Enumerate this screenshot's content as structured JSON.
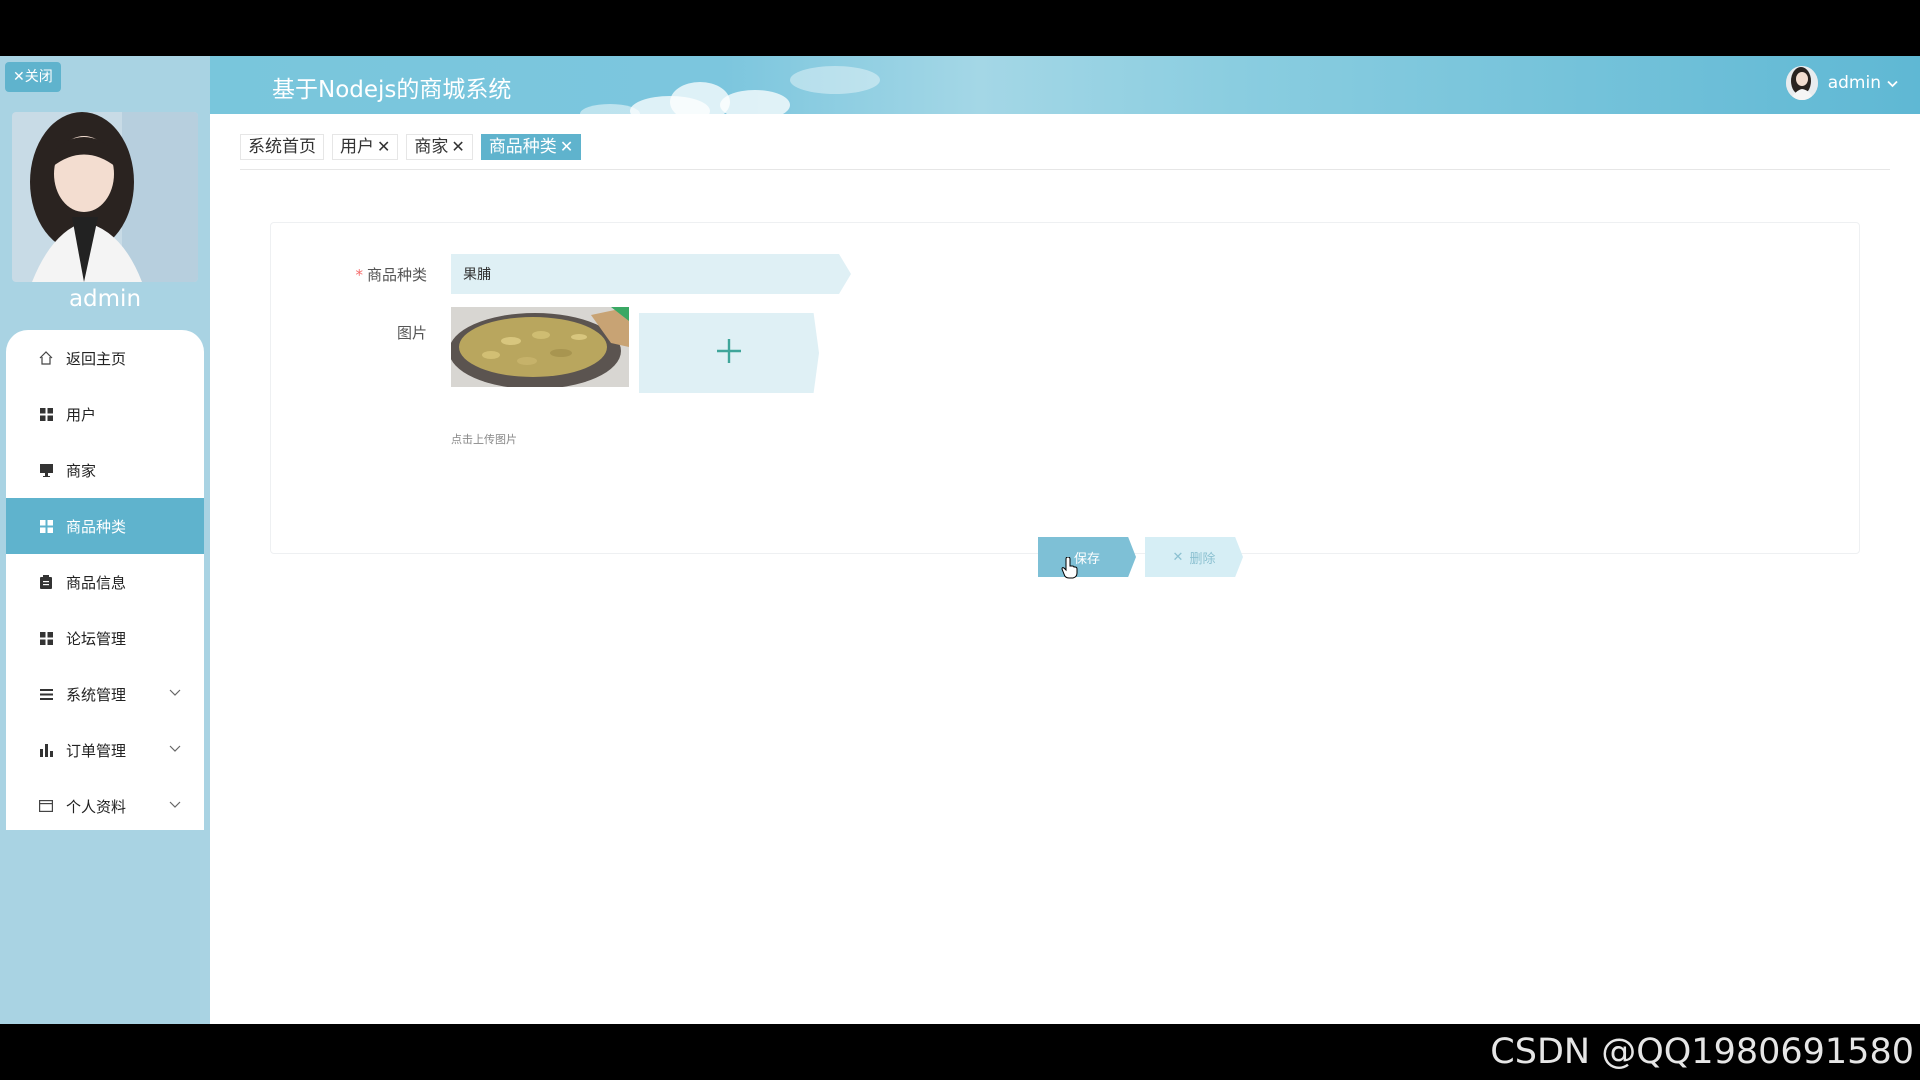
{
  "sidebar": {
    "close_label": "✕关闭",
    "username": "admin",
    "items": [
      {
        "label": "返回主页"
      },
      {
        "label": "用户"
      },
      {
        "label": "商家"
      },
      {
        "label": "商品种类"
      },
      {
        "label": "商品信息"
      },
      {
        "label": "论坛管理"
      },
      {
        "label": "系统管理"
      },
      {
        "label": "订单管理"
      },
      {
        "label": "个人资料"
      }
    ]
  },
  "header": {
    "title": "基于Nodejs的商城系统",
    "user": "admin"
  },
  "tabs": [
    {
      "label": "系统首页"
    },
    {
      "label": "用户",
      "close": "✕"
    },
    {
      "label": "商家",
      "close": "✕"
    },
    {
      "label": "商品种类",
      "close": "✕"
    }
  ],
  "form": {
    "required_mark": "*",
    "category_label": "商品种类",
    "category_value": "果脯",
    "image_label": "图片",
    "upload_tip": "点击上传图片",
    "save_label": "保存",
    "delete_label": "删除",
    "delete_icon": "✕"
  },
  "watermark": "CSDN @QQ1980691580",
  "colors": {
    "accent": "#5fb3cd",
    "sidebar_bg": "#a9d3e3",
    "input_bg": "#dff0f5"
  }
}
